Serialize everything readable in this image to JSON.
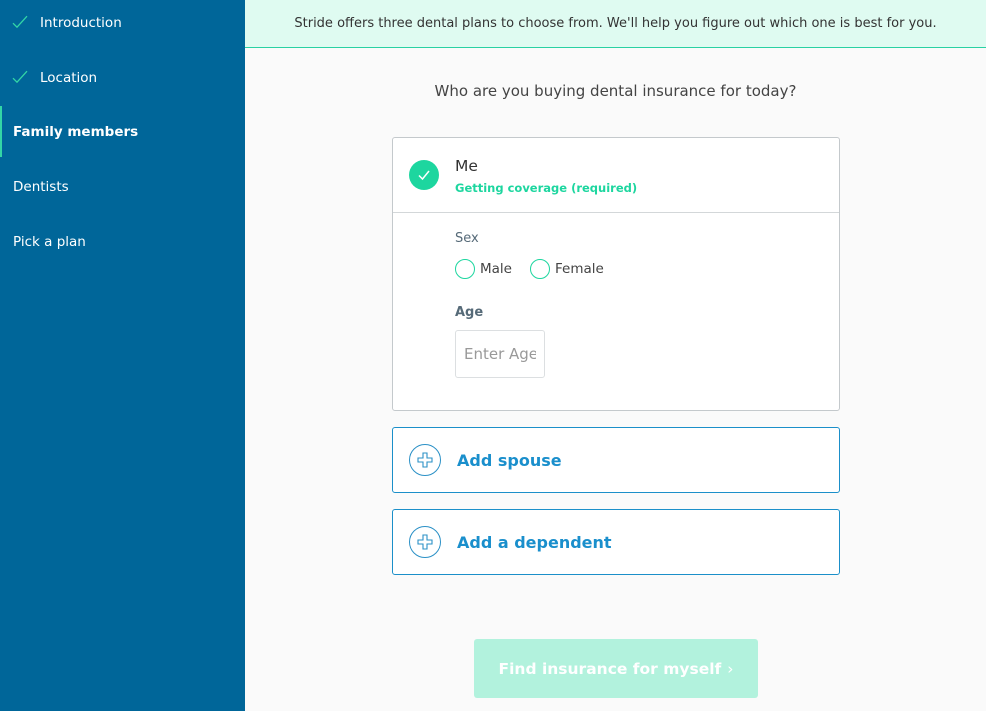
{
  "sidebar": {
    "items": [
      {
        "label": "Introduction",
        "state": "done"
      },
      {
        "label": "Location",
        "state": "done"
      },
      {
        "label": "Family members",
        "state": "active"
      },
      {
        "label": "Dentists",
        "state": "pending"
      },
      {
        "label": "Pick a plan",
        "state": "pending"
      }
    ],
    "icon": "checkmark-icon"
  },
  "banner": {
    "text": "Stride offers three dental plans to choose from. We'll help you figure out which one is best for you."
  },
  "main": {
    "question": "Who are you buying dental insurance for today?",
    "me_card": {
      "name": "Me",
      "subtitle": "Getting coverage (required)",
      "sex_label": "Sex",
      "sex_options": [
        "Male",
        "Female"
      ],
      "age_label": "Age",
      "age_value": "",
      "age_placeholder": "Enter Age"
    },
    "add_spouse": "Add spouse",
    "add_dependent": "Add a dependent",
    "cta": {
      "label": "Find insurance for myself",
      "chevron": "›"
    }
  },
  "colors": {
    "sidebar": "#006699",
    "accent": "#1dd69f",
    "link": "#1a8fcc",
    "banner": "#dffbf1"
  }
}
